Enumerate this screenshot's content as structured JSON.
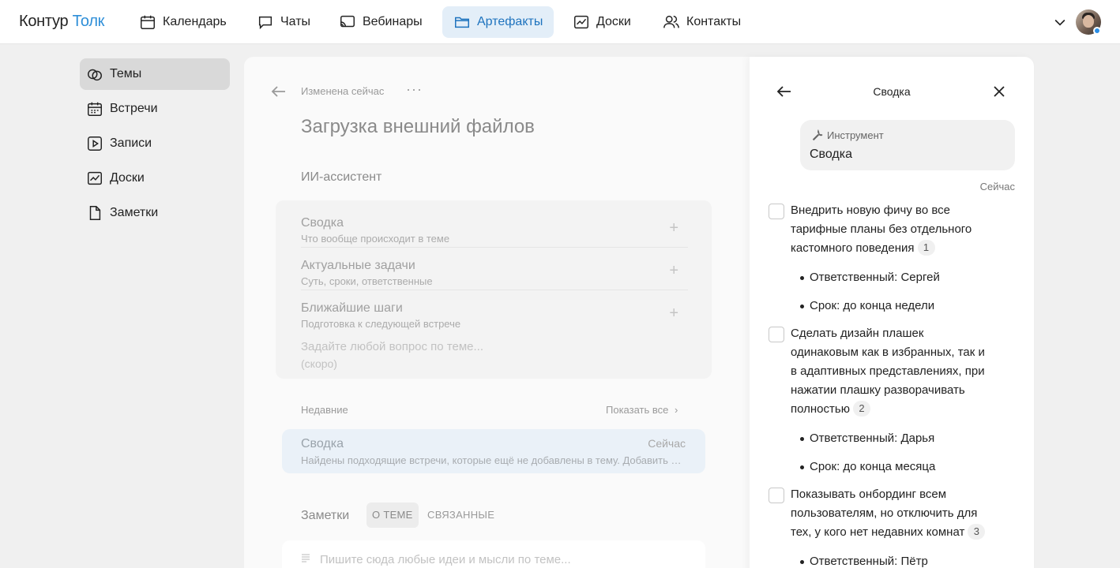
{
  "app": {
    "logo_main": "Контур",
    "logo_accent": "Толк"
  },
  "nav": [
    {
      "label": "Календарь",
      "icon": "calendar-icon"
    },
    {
      "label": "Чаты",
      "icon": "chat-icon"
    },
    {
      "label": "Вебинары",
      "icon": "webinar-icon"
    },
    {
      "label": "Артефакты",
      "icon": "folder-icon",
      "active": true
    },
    {
      "label": "Доски",
      "icon": "board-icon"
    },
    {
      "label": "Контакты",
      "icon": "contacts-icon"
    }
  ],
  "sidebar": [
    {
      "label": "Темы",
      "icon": "topics-icon",
      "active": true
    },
    {
      "label": "Встречи",
      "icon": "meetings-icon"
    },
    {
      "label": "Записи",
      "icon": "recordings-icon"
    },
    {
      "label": "Доски",
      "icon": "board-icon"
    },
    {
      "label": "Заметки",
      "icon": "note-icon"
    }
  ],
  "doc": {
    "changed": "Изменена сейчас",
    "more": "···",
    "title": "Загрузка внешний файлов",
    "ai_heading": "ИИ-ассистент",
    "ai_items": [
      {
        "title": "Сводка",
        "subtitle": "Что вообще происходит в теме",
        "action": "+"
      },
      {
        "title": "Актуальные задачи",
        "subtitle": "Суть, сроки, ответственные",
        "action": "+"
      },
      {
        "title": "Ближайшие шаги",
        "subtitle": "Подготовка к следующей встрече",
        "action": "+"
      }
    ],
    "ask_placeholder": "Задайте любой вопрос по теме...",
    "ask_note": "(скоро)",
    "recent_label": "Недавние",
    "show_all": "Показать все",
    "recent_card": {
      "title": "Сводка",
      "time": "Сейчас",
      "desc": "Найдены подходящие встречи, которые ещё не добавлены в тему. Добавить их?"
    },
    "notes_heading": "Заметки",
    "notes_tabs": [
      "О ТЕМЕ",
      "СВЯЗАННЫЕ"
    ],
    "notes_placeholder": "Пишите сюда любые идеи и мысли по теме..."
  },
  "summary": {
    "title": "Сводка",
    "tool_label": "Инструмент",
    "tool_value": "Сводка",
    "time": "Сейчас",
    "tasks": [
      {
        "text": "Внедрить новую фичу во все тарифные планы без отдельного кастомного поведения",
        "badge": "1"
      },
      {
        "text": "Сделать дизайн плашек одинаковым как в избранных, так и в адаптивных представлениях, при нажатии плашку разворачивать полностью",
        "badge": "2"
      },
      {
        "text": "Показывать онбординг всем пользователям, но отключить для тех, у кого нет недавних комнат",
        "badge": "3"
      }
    ],
    "bullets": [
      "Ответственный: Сергей",
      "Срок: до конца недели",
      "Ответственный: Дарья",
      "Срок: до конца месяца",
      "Ответственный: Пётр"
    ]
  }
}
